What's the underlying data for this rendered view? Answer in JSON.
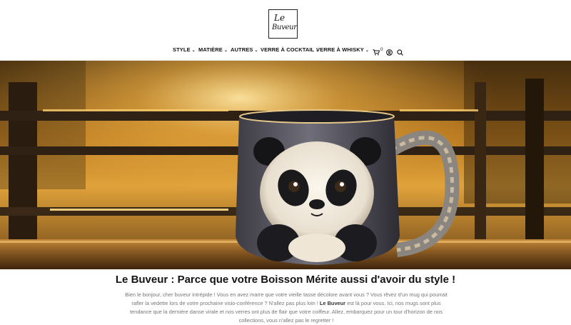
{
  "brand": {
    "logo_line1": "Le",
    "logo_line2": "Buveur"
  },
  "nav": {
    "items": [
      {
        "label": "STYLE"
      },
      {
        "label": "MATIÈRE"
      },
      {
        "label": "AUTRES"
      },
      {
        "label": "VERRE À COCKTAIL"
      },
      {
        "label": "VERRE À WHISKY"
      }
    ],
    "cart_count": "0",
    "icons": [
      "cart-icon",
      "user-icon",
      "search-icon",
      "chevron-down-icon"
    ]
  },
  "hero": {
    "image": "panda-mug-photo"
  },
  "article": {
    "title": "Le Buveur : Parce que votre Boisson Mérite aussi d'avoir du style !",
    "intro_part1": "Bien le bonjour, cher buveur intrépide ! Vous en avez marre que votre vieille tasse décolore avant vous ? Vous rêvez d'un mug qui pourrait rafler la vedette lors de votre prochaine visio-conférence ? N'allez pas plus loin ! ",
    "intro_strong": "Le Buveur",
    "intro_part2": " est là pour vous. Ici, nos mugs sont plus tendance que la dernière danse virale et nos verres ont plus de flair que votre coiffeur. Allez, embarquez pour un tour d'horizon de nos collections, vous n'allez pas le regretter !"
  },
  "colors": {
    "accent": "#f2a31b",
    "text": "#141414",
    "muted": "#777777"
  }
}
